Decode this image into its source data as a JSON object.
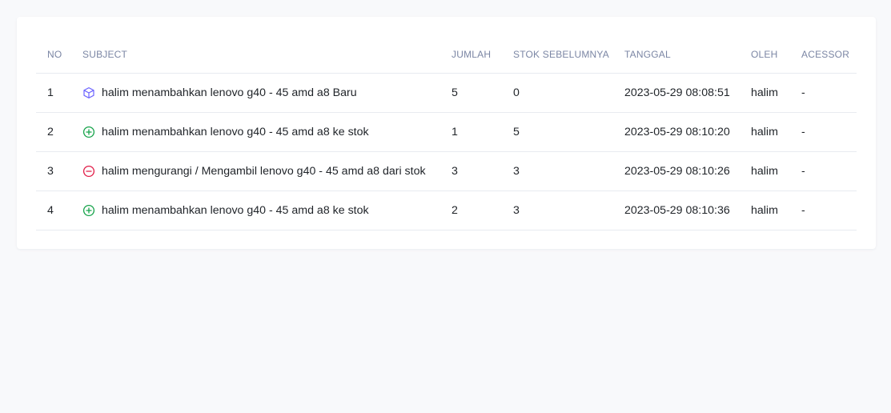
{
  "table": {
    "headers": {
      "no": "NO",
      "subject": "SUBJECT",
      "jumlah": "JUMLAH",
      "stok_sebelumnya": "STOK SEBELUMNYA",
      "tanggal": "TANGGAL",
      "oleh": "OLEH",
      "acessor": "ACESSOR"
    },
    "rows": [
      {
        "no": "1",
        "icon": "cube-icon",
        "subject": "halim menambahkan lenovo g40 - 45 amd a8 Baru",
        "jumlah": "5",
        "stok_sebelumnya": "0",
        "tanggal": "2023-05-29 08:08:51",
        "oleh": "halim",
        "acessor": "-"
      },
      {
        "no": "2",
        "icon": "plus-circle-icon",
        "subject": "halim menambahkan lenovo g40 - 45 amd a8 ke stok",
        "jumlah": "1",
        "stok_sebelumnya": "5",
        "tanggal": "2023-05-29 08:10:20",
        "oleh": "halim",
        "acessor": "-"
      },
      {
        "no": "3",
        "icon": "minus-circle-icon",
        "subject": "halim mengurangi / Mengambil lenovo g40 - 45 amd a8 dari stok",
        "jumlah": "3",
        "stok_sebelumnya": "3",
        "tanggal": "2023-05-29 08:10:26",
        "oleh": "halim",
        "acessor": "-"
      },
      {
        "no": "4",
        "icon": "plus-circle-icon",
        "subject": "halim menambahkan lenovo g40 - 45 amd a8 ke stok",
        "jumlah": "2",
        "stok_sebelumnya": "3",
        "tanggal": "2023-05-29 08:10:36",
        "oleh": "halim",
        "acessor": "-"
      }
    ]
  },
  "colors": {
    "cube": "#6c63ff",
    "plus": "#16a34a",
    "minus": "#e11d48",
    "header_text": "#7b86a4",
    "background": "#f8f9fb"
  }
}
